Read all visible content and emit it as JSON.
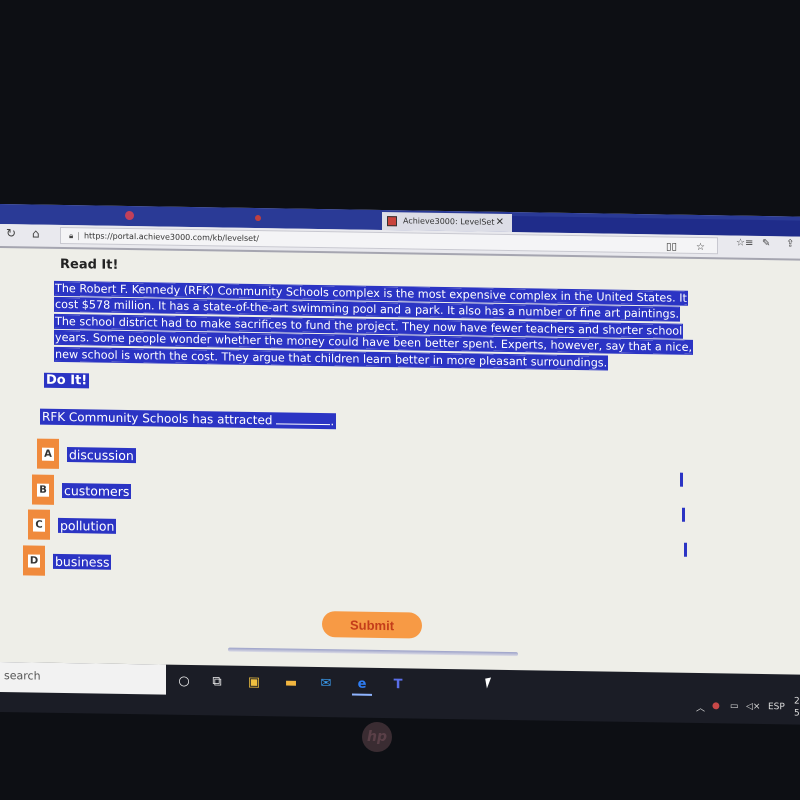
{
  "browser": {
    "tabs": [
      {
        "label": "",
        "active": false
      },
      {
        "label": "",
        "active": false
      },
      {
        "label": "Achieve3000: LevelSet",
        "active": true
      }
    ],
    "close_glyph": "✕",
    "url": "https://portal.achieve3000.com/kb/levelset/",
    "icons": [
      "refresh-icon",
      "home-icon",
      "lock-icon",
      "reading-view-icon",
      "favorite-star-icon",
      "favorites-list-icon",
      "pen-icon",
      "share-icon"
    ]
  },
  "content": {
    "read_title": "Read It!",
    "passage_lines": [
      "The Robert F. Kennedy (RFK) Community Schools complex is the most expensive complex in the United States. It",
      "cost $578 million. It has a state-of-the-art swimming pool and a park. It also has a number of fine art paintings.",
      "The school district had to make sacrifices to fund the project. They now have fewer teachers and shorter school",
      "years. Some people wonder whether the money could have been better spent. Experts, however, say that a nice,",
      "new school is worth the cost. They argue that children learn better in more pleasant surroundings."
    ],
    "do_title": "Do It!",
    "question": "RFK Community Schools has attracted",
    "question_end": ".",
    "options": [
      {
        "letter": "A",
        "text": "discussion"
      },
      {
        "letter": "B",
        "text": "customers"
      },
      {
        "letter": "C",
        "text": "pollution"
      },
      {
        "letter": "D",
        "text": "business"
      }
    ],
    "submit_label": "Submit"
  },
  "taskbar": {
    "search_placeholder": "search",
    "apps": [
      "cortana-icon",
      "task-view-icon",
      "store-icon",
      "file-explorer-icon",
      "mail-icon",
      "edge-icon",
      "teams-icon"
    ],
    "tray": {
      "language": "ESP",
      "clock_top": "2",
      "clock_bottom": "5"
    }
  },
  "colors": {
    "highlight": "#2b34c4",
    "accent_orange": "#f08a3c",
    "submit_text": "#c43d1a",
    "tab_strip": "#2a3a96"
  }
}
